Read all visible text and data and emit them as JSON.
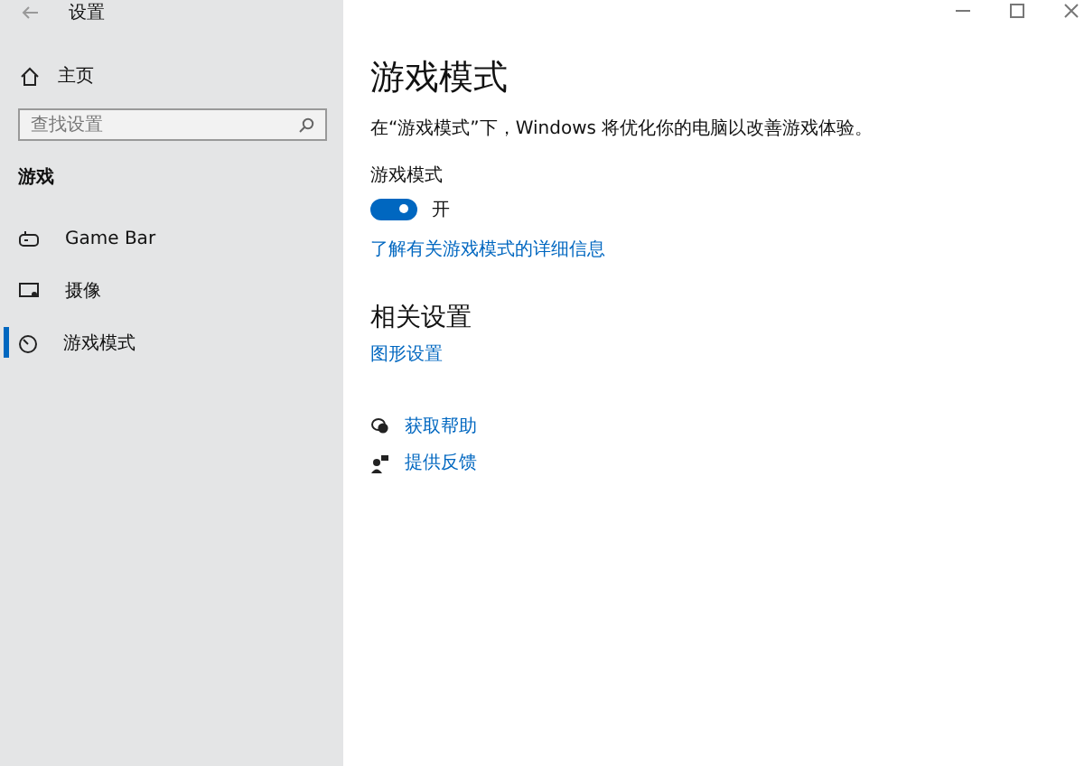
{
  "window": {
    "title": "设置"
  },
  "sidebar": {
    "home": "主页",
    "search": {
      "placeholder": "查找设置"
    },
    "section": "游戏",
    "items": [
      {
        "label": "Game Bar",
        "kind": "gamebar",
        "selected": false
      },
      {
        "label": "摄像",
        "kind": "capture",
        "selected": false
      },
      {
        "label": "游戏模式",
        "kind": "gamemode",
        "selected": true
      }
    ]
  },
  "main": {
    "title": "游戏模式",
    "description": "在“游戏模式”下，Windows 将优化你的电脑以改善游戏体验。",
    "toggle": {
      "label": "游戏模式",
      "on": true,
      "state_text": "开"
    },
    "learn_more": "了解有关游戏模式的详细信息",
    "related": {
      "heading": "相关设置",
      "links": [
        "图形设置"
      ]
    },
    "help": [
      {
        "label": "获取帮助",
        "kind": "help"
      },
      {
        "label": "提供反馈",
        "kind": "feedback"
      }
    ]
  }
}
